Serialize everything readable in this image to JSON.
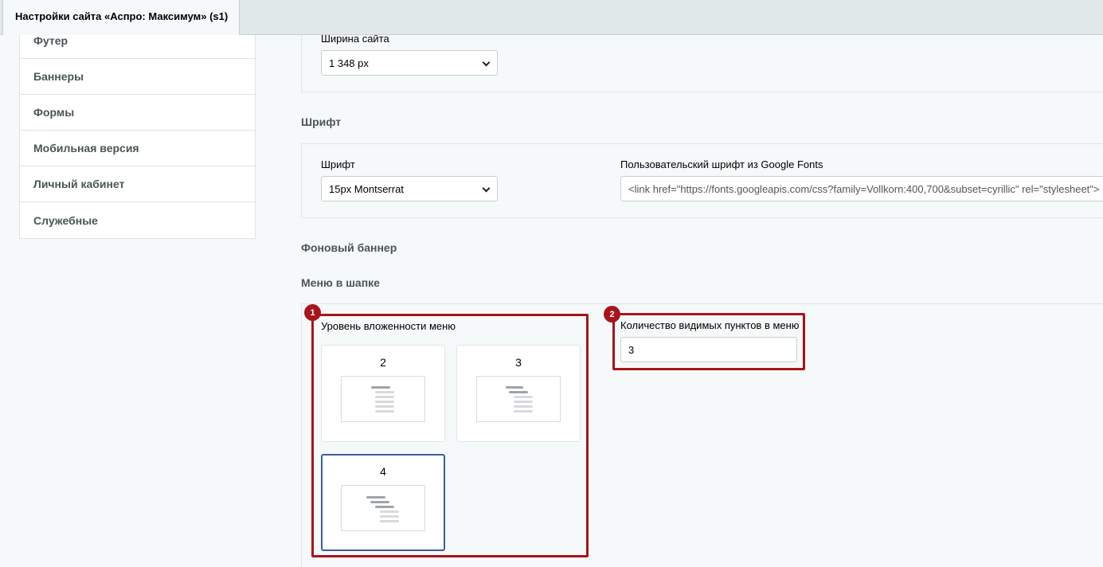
{
  "tab": {
    "label": "Настройки сайта «Аспро: Максимум» (s1)"
  },
  "sidebar": {
    "items": [
      {
        "label": "Футер"
      },
      {
        "label": "Баннеры"
      },
      {
        "label": "Формы"
      },
      {
        "label": "Мобильная версия"
      },
      {
        "label": "Личный кабинет"
      },
      {
        "label": "Служебные"
      }
    ]
  },
  "site_width": {
    "label": "Ширина сайта",
    "value": "1 348 px"
  },
  "font_section": {
    "heading": "Шрифт",
    "font_label": "Шрифт",
    "font_value": "15px Montserrat",
    "custom_label": "Пользовательский шрифт из Google Fonts",
    "custom_value": "<link href=\"https://fonts.googleapis.com/css?family=Vollkorn:400,700&subset=cyrillic\" rel=\"stylesheet\">"
  },
  "bg_banner": {
    "heading": "Фоновый баннер"
  },
  "header_menu": {
    "heading": "Меню в шапке",
    "depth_label": "Уровень вложенности меню",
    "depth_options": [
      {
        "label": "2"
      },
      {
        "label": "3"
      },
      {
        "label": "4"
      }
    ],
    "depth_selected": "4",
    "visible_label": "Количество видимых пунктов в меню",
    "visible_value": "3"
  },
  "annotations": [
    {
      "number": "1"
    },
    {
      "number": "2"
    }
  ],
  "colors": {
    "annotation": "#a8141c",
    "selected_border": "#3b5e9a"
  }
}
